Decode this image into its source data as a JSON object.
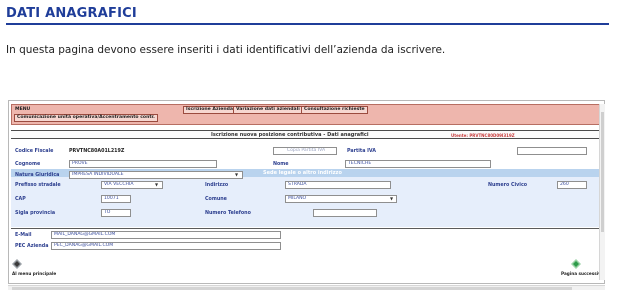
{
  "slide": {
    "title": "DATI ANAGRAFICI",
    "intro": "In questa pagina devono essere inseriti i dati identificativi dell’azienda da iscrivere."
  },
  "menu": {
    "label": "MENU",
    "sub_label": "Comunicazione unità operativa/Accentramento contr.",
    "links": [
      "Iscrizione Azienda",
      "Variazione dati aziendali",
      "Consultazione richieste"
    ]
  },
  "header": {
    "title": "Iscrizione nuova posizione contributiva  - Dati anagrafici",
    "user": "Utente: PRVTNC80D09I319Z"
  },
  "fields": {
    "codice_fiscale": {
      "label": "Codice Fiscale",
      "value": "PRVTNC80A01L219Z"
    },
    "copia_piva": {
      "label": "Copia Partita IVA"
    },
    "partita_iva": {
      "label": "Partita IVA",
      "value": ""
    },
    "cognome": {
      "label": "Cognome",
      "value": "PROVE"
    },
    "nome": {
      "label": "Nome",
      "value": "TECNICHE"
    },
    "natura_giuridica": {
      "label": "Natura Giuridica",
      "value": "IMPRESA INDIVIDUALE"
    }
  },
  "section": {
    "title": "Sede legale o altro indirizzo",
    "prefisso_stradale": {
      "label": "Prefisso stradale",
      "value": "VIA VECCHIA"
    },
    "indirizzo": {
      "label": "Indirizzo",
      "value": "STRADA"
    },
    "numero_civico": {
      "label": "Numero Civico",
      "value": "260"
    },
    "cap": {
      "label": "CAP",
      "value": "10071"
    },
    "comune": {
      "label": "Comune",
      "value": "MILANO"
    },
    "sigla_provincia": {
      "label": "Sigla provincia",
      "value": "TO"
    },
    "numero_telefono": {
      "label": "Numero Telefono",
      "value": ""
    }
  },
  "contacts": {
    "email": {
      "label": "E-Mail",
      "value": "MAIL_DANAG@GMAIL.COM"
    },
    "pec": {
      "label": "PEC Azienda",
      "value": "PEC_DANAG@GMAIL.COM"
    }
  },
  "nav": {
    "prev_label": "Al menu principale",
    "next_label": "Pagina successiva"
  },
  "colors": {
    "title_blue": "#1f3d99",
    "menu_bg": "#eeb6ad",
    "section_bg": "#b9d3ee",
    "section_body": "#e6eefb",
    "label_blue": "#2d3f8f"
  }
}
